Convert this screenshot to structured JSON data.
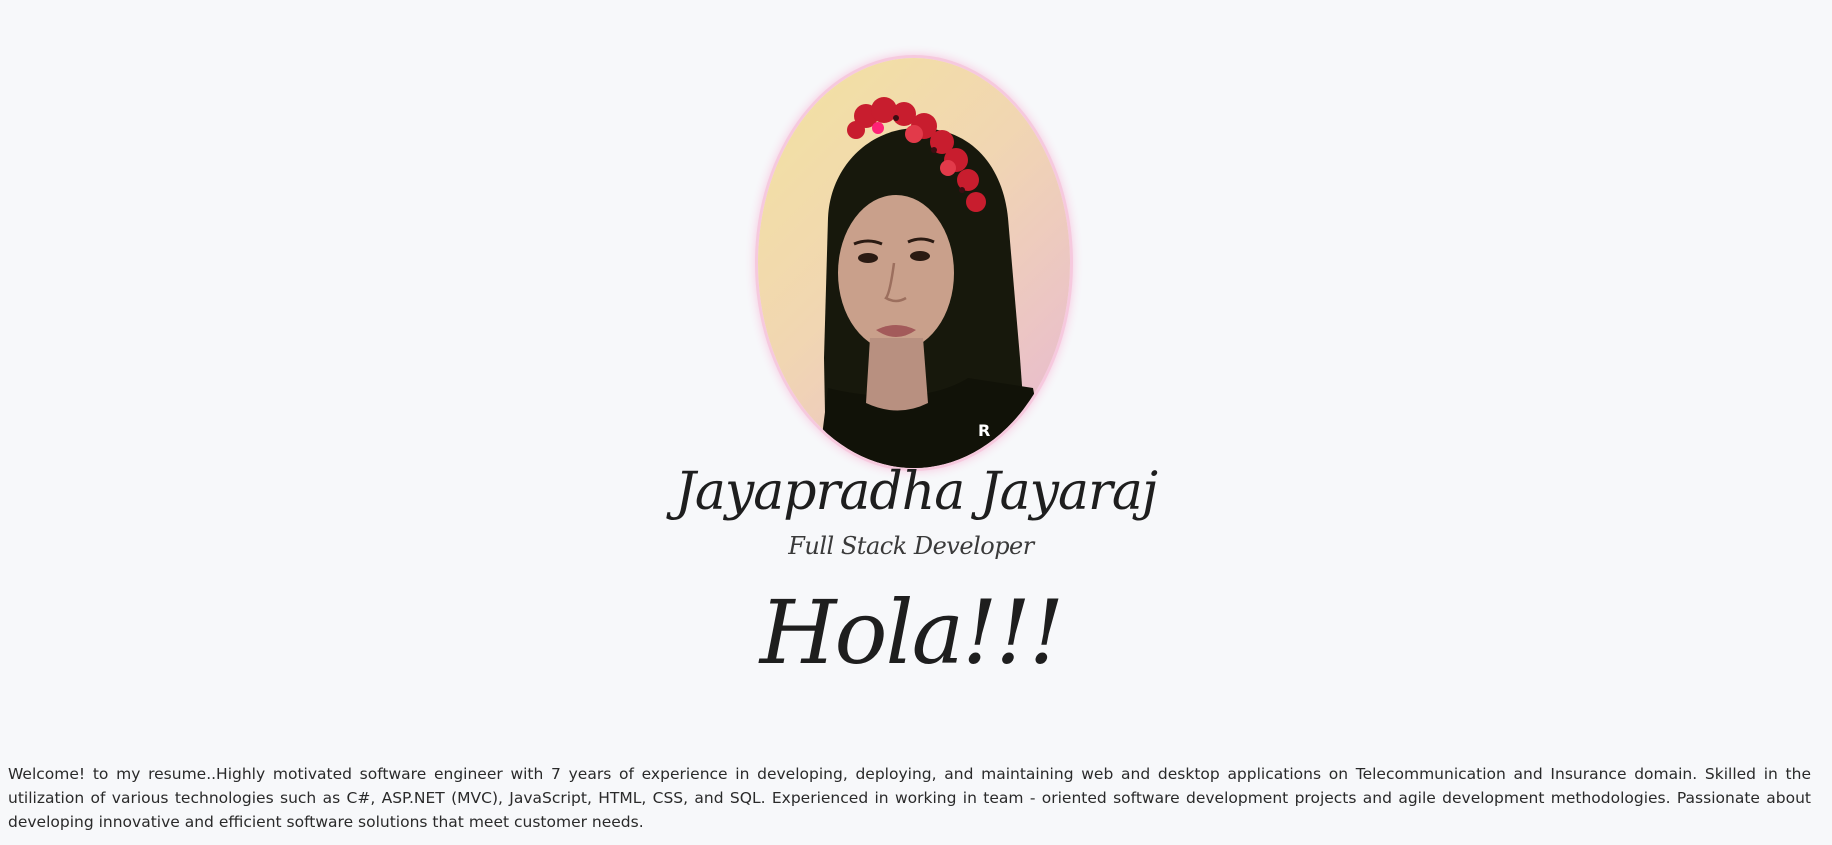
{
  "profile": {
    "name": "Jayapradha Jayaraj",
    "role": "Full Stack Developer",
    "photo_alt": "Profile photo"
  },
  "greeting": "Hola!!!",
  "intro": "Welcome! to my resume..Highly motivated software engineer with 7 years of experience in developing, deploying, and maintaining web and desktop applications on Telecommunication and Insurance domain. Skilled in the utilization of various technologies such as C#, ASP.NET (MVC), JavaScript, HTML, CSS, and SQL. Experienced in working in team - oriented software development projects and agile development methodologies. Passionate about developing innovative and efficient software solutions that meet customer needs.",
  "colors": {
    "background": "#f7f8fa",
    "portrait_glow": "#f6c9de"
  }
}
